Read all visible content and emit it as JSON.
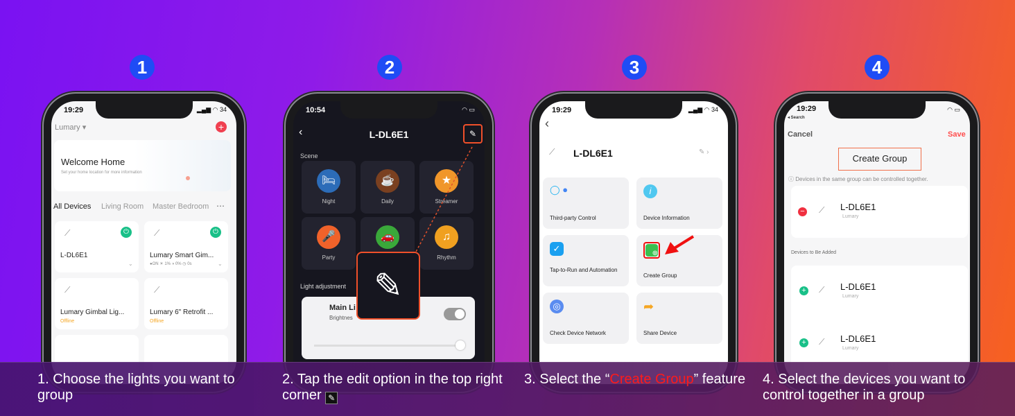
{
  "steps": [
    {
      "number": "1",
      "caption": "1. Choose the lights you want to group"
    },
    {
      "number": "2",
      "caption": "2. Tap the edit option in the top right corner"
    },
    {
      "number": "3",
      "caption_pre": "3. Select the “",
      "caption_highlight": "Create Group",
      "caption_post": "” feature"
    },
    {
      "number": "4",
      "caption": "4. Select the devices you want to control together in a group"
    }
  ],
  "colors": {
    "number_badge": "#1f4cf5",
    "highlight": "#ff1a1a",
    "power_on": "#19c088",
    "offline": "#f5a623",
    "save": "#ff4d4d"
  },
  "phone1": {
    "time": "19:29",
    "battery": "34",
    "home": "Lumary",
    "welcome_title": "Welcome Home",
    "welcome_sub": "Set your home location for more information",
    "tabs": [
      "All Devices",
      "Living Room",
      "Master Bedroom"
    ],
    "more": "⋯",
    "devices": [
      {
        "name": "L-DL6E1",
        "power": "on"
      },
      {
        "name": "Lumary Smart Gim...",
        "power": "on",
        "status": "●ON  ☀ 1%  ◑ 0%  ◷ 0s"
      },
      {
        "name": "Lumary Gimbal Lig...",
        "status": "Offline"
      },
      {
        "name": "Lumary 6\" Retrofit ...",
        "status": "Offline"
      }
    ]
  },
  "phone2": {
    "time": "10:54",
    "title": "L-DL6E1",
    "scene_label": "Scene",
    "scenes": [
      {
        "name": "Night",
        "color": "#2c6cb8",
        "icon": "bed-icon"
      },
      {
        "name": "Daily",
        "color": "#7a4020",
        "icon": "coffee-icon"
      },
      {
        "name": "Streamer",
        "color": "#f0962a",
        "icon": "star-icon"
      },
      {
        "name": "Party",
        "color": "#f0622a",
        "icon": "microphone-icon"
      },
      {
        "name": "",
        "color": "#3aa83a",
        "icon": "car-icon"
      },
      {
        "name": "Rhythm",
        "color": "#f0a020",
        "icon": "music-icon"
      }
    ],
    "light_adjustment": "Light adjustment",
    "main_light": "Main Li",
    "brightness": "Brightnes"
  },
  "phone3": {
    "time": "19:29",
    "battery": "34",
    "device": "L-DL6E1",
    "options": [
      "Third-party Control",
      "Device Information",
      "Tap-to-Run and Automation",
      "Create Group",
      "Check Device Network",
      "Share Device"
    ]
  },
  "phone4": {
    "time": "19:29",
    "back": "◂ Search",
    "cancel": "Cancel",
    "save": "Save",
    "title": "Create Group",
    "info": "Devices in the same group can be controlled together.",
    "section": "Devices to Be Added",
    "in_group": [
      {
        "name": "L-DL6E1",
        "brand": "Lumary"
      }
    ],
    "to_add": [
      {
        "name": "L-DL6E1",
        "brand": "Lumary"
      },
      {
        "name": "L-DL6E1",
        "brand": "Lumary"
      }
    ]
  }
}
